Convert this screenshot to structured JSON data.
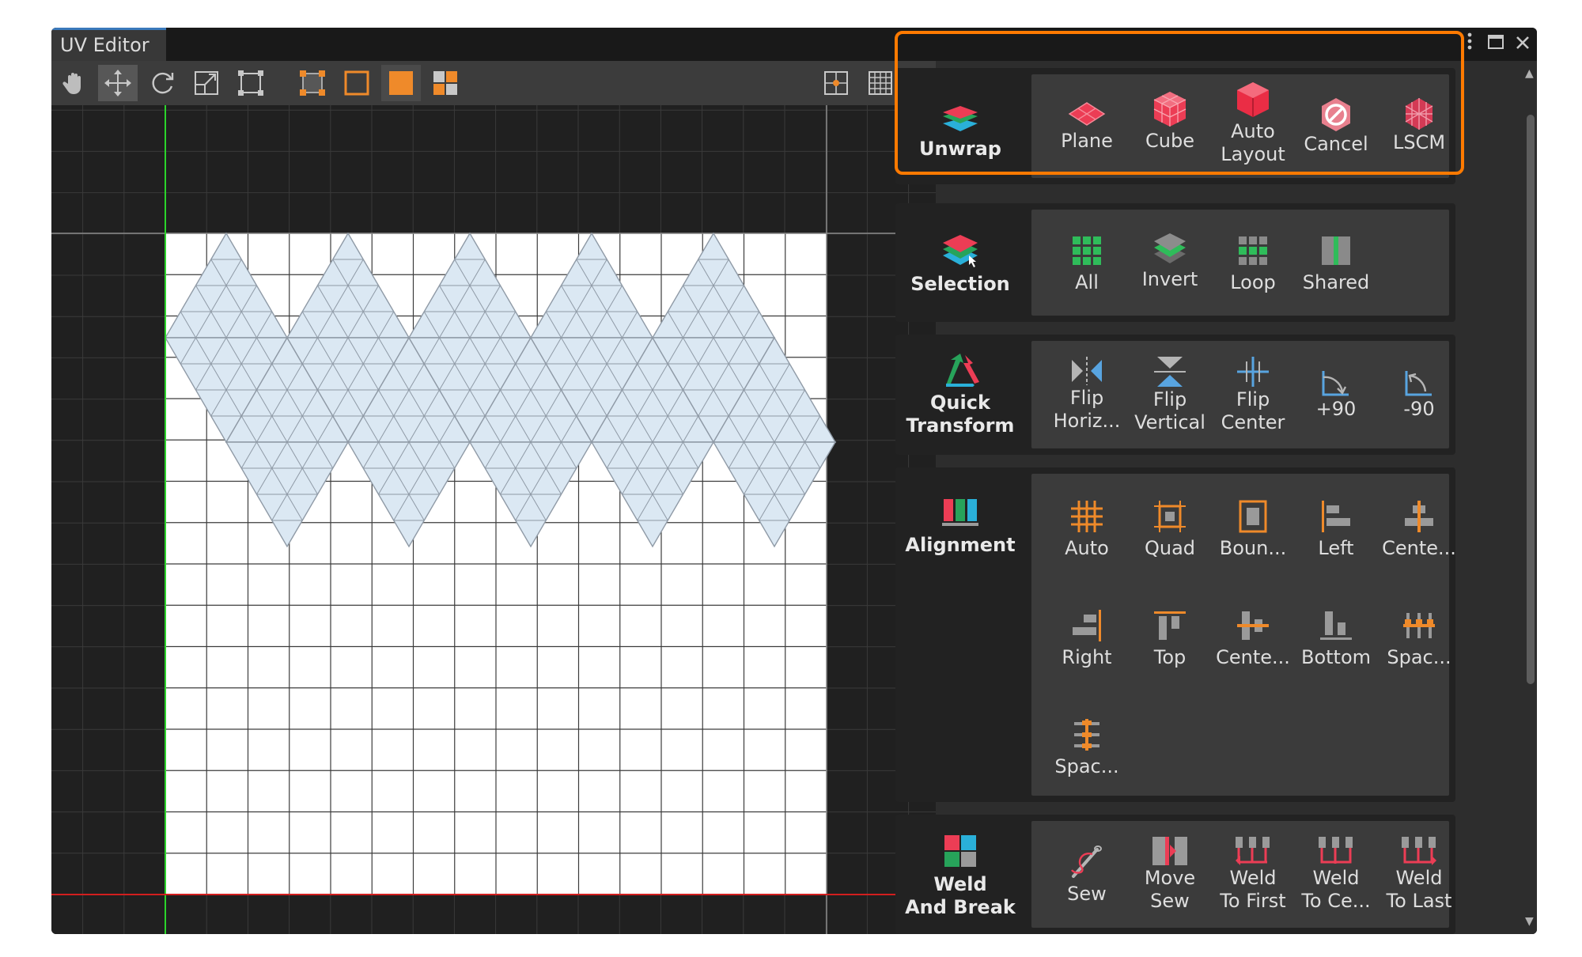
{
  "window": {
    "tab_title": "UV Editor",
    "menu_icon": "kebab-menu-icon",
    "maximize_icon": "maximize-icon",
    "close_icon": "close-icon"
  },
  "toolbar": {
    "tools": [
      "hand-tool",
      "move-tool",
      "rotate-tool",
      "scale-tool",
      "rect-tool"
    ],
    "select_modes": [
      "vertex-select",
      "edge-select",
      "face-select",
      "island-select"
    ],
    "active_tool": "move-tool",
    "active_select_mode": "face-select",
    "right_icons": [
      "pivot-icon",
      "grid-snap-icon",
      "settings-icon"
    ]
  },
  "colors": {
    "accent_orange": "#ff7a00",
    "uv_fill": "#dbe8f3",
    "uv_edge": "#8f9aa6",
    "v_axis": "#2bd42b",
    "u_axis": "#d21e1e"
  },
  "sections": [
    {
      "id": "unwrap",
      "label": "Unwrap",
      "highlighted": true,
      "buttons": [
        {
          "label": "Plane",
          "icon": "plane-icon"
        },
        {
          "label": "Cube",
          "icon": "cube-icon"
        },
        {
          "label": "Auto\nLayout",
          "icon": "auto-layout-icon"
        },
        {
          "label": "Cancel",
          "icon": "cancel-icon"
        },
        {
          "label": "LSCM",
          "icon": "lscm-icon"
        }
      ]
    },
    {
      "id": "selection",
      "label": "Selection",
      "buttons": [
        {
          "label": "All",
          "icon": "select-all-icon"
        },
        {
          "label": "Invert",
          "icon": "select-invert-icon"
        },
        {
          "label": "Loop",
          "icon": "select-loop-icon"
        },
        {
          "label": "Shared",
          "icon": "select-shared-icon"
        }
      ]
    },
    {
      "id": "quick-transform",
      "label": "Quick\nTransform",
      "buttons": [
        {
          "label": "Flip\nHoriz...",
          "icon": "flip-horizontal-icon"
        },
        {
          "label": "Flip\nVertical",
          "icon": "flip-vertical-icon"
        },
        {
          "label": "Flip\nCenter",
          "icon": "flip-center-icon"
        },
        {
          "label": "+90",
          "icon": "rotate-plus-90-icon"
        },
        {
          "label": "-90",
          "icon": "rotate-minus-90-icon"
        }
      ]
    },
    {
      "id": "alignment",
      "label": "Alignment",
      "buttons": [
        {
          "label": "Auto",
          "icon": "align-auto-icon"
        },
        {
          "label": "Quad",
          "icon": "align-quad-icon"
        },
        {
          "label": "Boun...",
          "icon": "align-bounds-icon"
        },
        {
          "label": "Left",
          "icon": "align-left-icon"
        },
        {
          "label": "Cente...",
          "icon": "align-center-vertical-icon"
        },
        {
          "label": "Right",
          "icon": "align-right-icon"
        },
        {
          "label": "Top",
          "icon": "align-top-icon"
        },
        {
          "label": "Cente...",
          "icon": "align-center-horizontal-icon"
        },
        {
          "label": "Bottom",
          "icon": "align-bottom-icon"
        },
        {
          "label": "Spac...",
          "icon": "space-horizontal-icon"
        },
        {
          "label": "Spac...",
          "icon": "space-vertical-icon"
        }
      ]
    },
    {
      "id": "weld-and-break",
      "label": "Weld\nAnd Break",
      "buttons": [
        {
          "label": "Sew",
          "icon": "sew-icon"
        },
        {
          "label": "Move\nSew",
          "icon": "move-sew-icon"
        },
        {
          "label": "Weld\nTo First",
          "icon": "weld-to-first-icon"
        },
        {
          "label": "Weld\nTo Ce...",
          "icon": "weld-to-center-icon"
        },
        {
          "label": "Weld\nTo Last",
          "icon": "weld-to-last-icon"
        }
      ]
    }
  ]
}
